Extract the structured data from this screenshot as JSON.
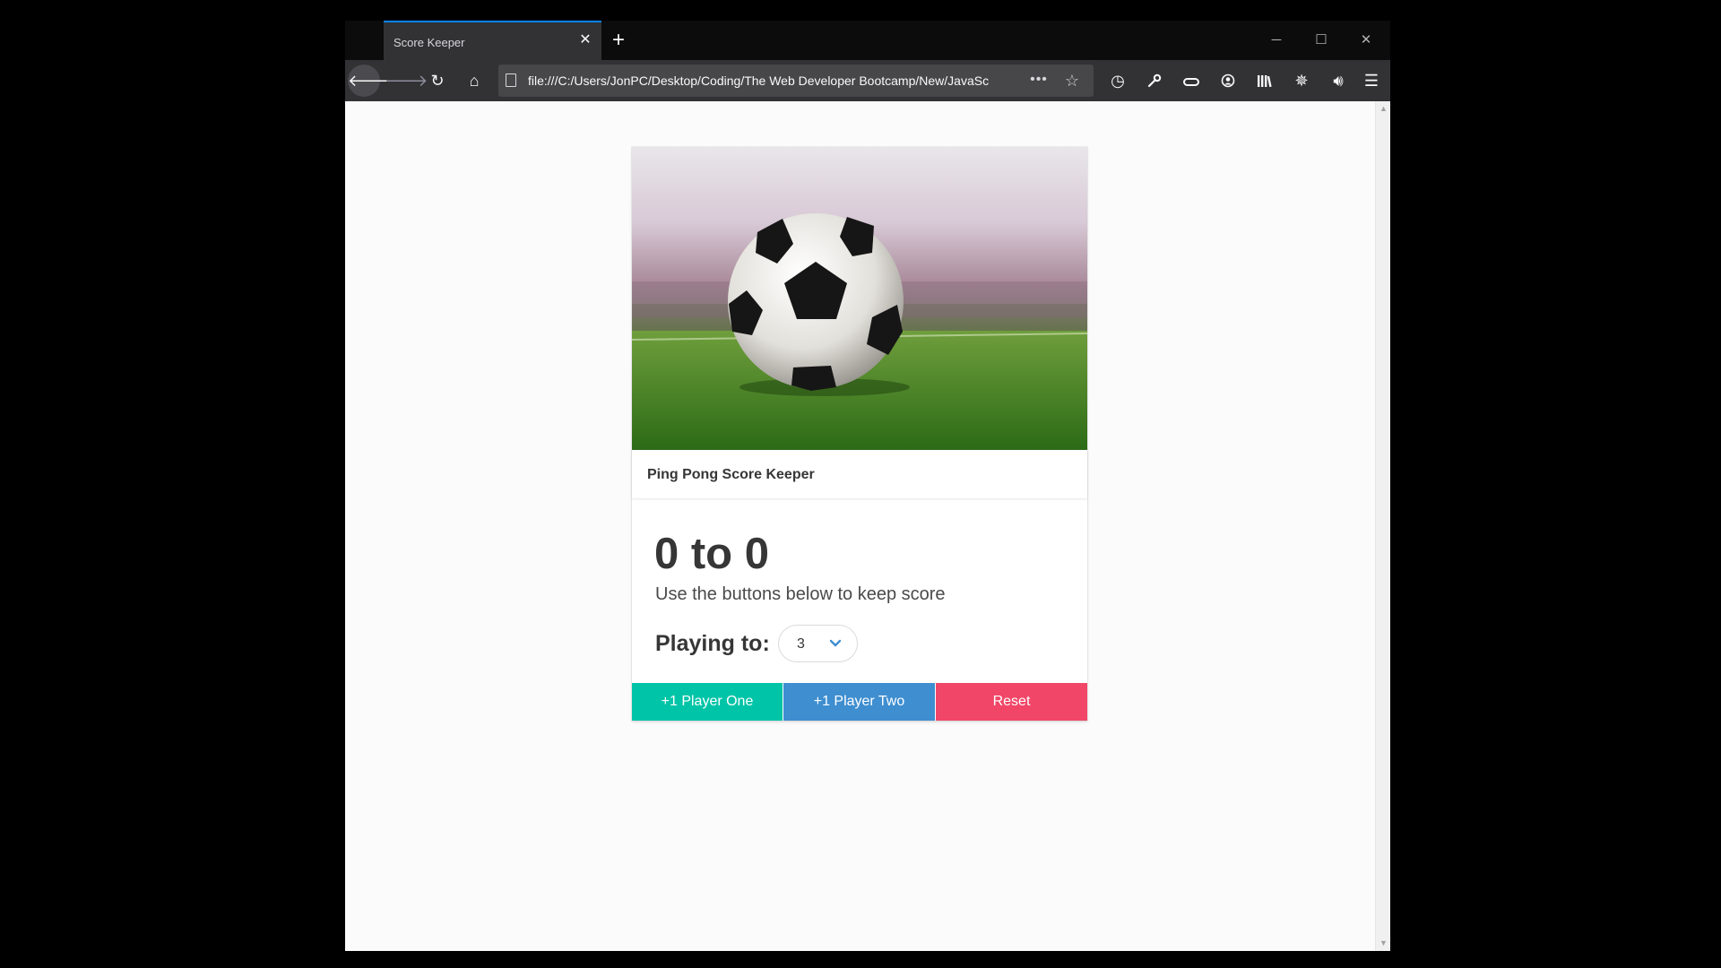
{
  "browser": {
    "tab_title": "Score Keeper",
    "url": "file:///C:/Users/JonPC/Desktop/Coding/The Web Developer Bootcamp/New/JavaSc",
    "toolbar_icons": [
      "back-arrow-icon",
      "forward-arrow-icon",
      "reload-icon",
      "home-icon",
      "page-icon",
      "more-dots-icon",
      "bookmark-star-icon",
      "history-clock-icon",
      "wrench-icon",
      "mask-icon",
      "account-icon",
      "library-icon",
      "extension-icon",
      "speaker-icon",
      "hamburger-menu-icon"
    ]
  },
  "card": {
    "image_description": "soccer-ball-stadium-image",
    "title": "Ping Pong Score Keeper",
    "score": "0 to 0",
    "subtitle": "Use the buttons below to keep score",
    "playing_label": "Playing to:",
    "select_value": "3"
  },
  "buttons": {
    "player_one": "+1 Player One",
    "player_two": "+1 Player Two",
    "reset": "Reset"
  },
  "colors": {
    "player_one": "#00c4a7",
    "player_two": "#3e8ed0",
    "reset": "#f14668",
    "tab_accent": "#0a84ff"
  }
}
